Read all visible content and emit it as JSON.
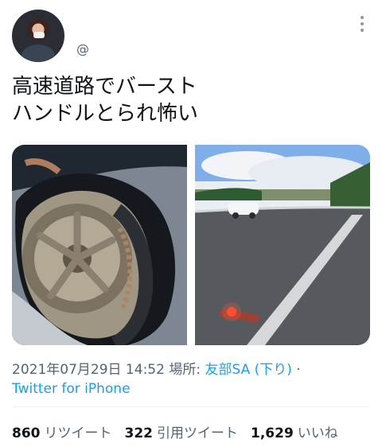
{
  "tweet": {
    "handle": "@",
    "text": "高速道路でバースト\nハンドルとられ怖い",
    "media": [
      {
        "name": "tire-photo"
      },
      {
        "name": "highway-photo"
      }
    ],
    "timestamp": "2021年07月29日 14:52",
    "location_label": "場所:",
    "location_value": "友部SA (下り)",
    "separator": "·",
    "source": "Twitter for iPhone",
    "stats": [
      {
        "count": "860",
        "label": "リツイート"
      },
      {
        "count": "322",
        "label": "引用ツイート"
      },
      {
        "count": "1,629",
        "label": "いいね"
      }
    ]
  }
}
